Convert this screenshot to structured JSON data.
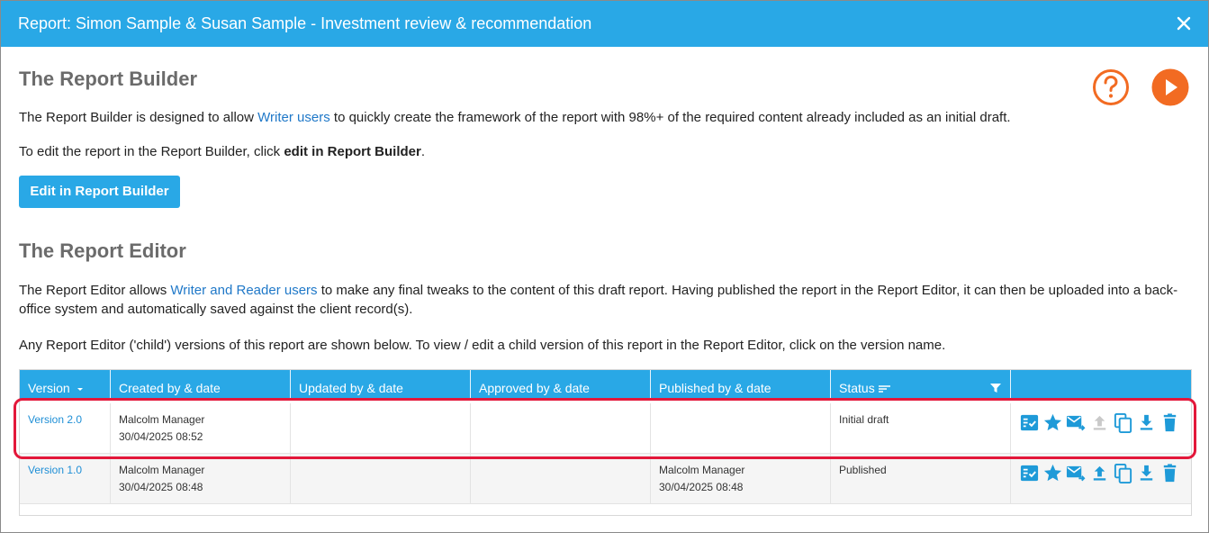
{
  "window": {
    "title": "Report: Simon Sample & Susan Sample - Investment review & recommendation"
  },
  "builder": {
    "heading": "The Report Builder",
    "intro_before": "The Report Builder is designed to allow ",
    "intro_link": "Writer users",
    "intro_after": " to quickly create the framework of the report with 98%+ of the required content already included as an initial draft.",
    "edit_before": "To edit the report in the Report Builder, click ",
    "edit_bold": "edit in Report Builder",
    "edit_after": ".",
    "button_label": "Edit in Report Builder"
  },
  "editor": {
    "heading": "The Report Editor",
    "intro_before": "The Report Editor allows ",
    "intro_link": "Writer and Reader users",
    "intro_after": " to make any final tweaks to the content of this draft report. Having published the report in the Report Editor, it can then be uploaded into a back-office system and automatically saved against the client record(s).",
    "child_text": "Any Report Editor ('child') versions of this report are shown below. To view / edit a child version of this report in the Report Editor, click on the version name."
  },
  "table": {
    "columns": [
      "Version",
      "Created by & date",
      "Updated by & date",
      "Approved by & date",
      "Published by & date",
      "Status"
    ],
    "rows": [
      {
        "version": "Version 2.0",
        "created_by": "Malcolm Manager",
        "created_date": "30/04/2025 08:52",
        "updated_by": "",
        "updated_date": "",
        "approved_by": "",
        "approved_date": "",
        "published_by": "",
        "published_date": "",
        "status": "Initial draft"
      },
      {
        "version": "Version 1.0",
        "created_by": "Malcolm Manager",
        "created_date": "30/04/2025 08:48",
        "updated_by": "",
        "updated_date": "",
        "approved_by": "",
        "approved_date": "",
        "published_by": "Malcolm Manager",
        "published_date": "30/04/2025 08:48",
        "status": "Published"
      }
    ]
  },
  "colors": {
    "accent": "#29a8e6",
    "orange": "#f26b22",
    "highlight": "#e3173a",
    "link": "#1f78c8"
  },
  "icons": [
    "close-icon",
    "help-icon",
    "play-icon",
    "sort-down-icon",
    "sort-lines-icon",
    "filter-icon",
    "checklist-icon",
    "star-icon",
    "email-forward-icon",
    "upload-icon",
    "copy-icon",
    "download-icon",
    "delete-icon"
  ]
}
